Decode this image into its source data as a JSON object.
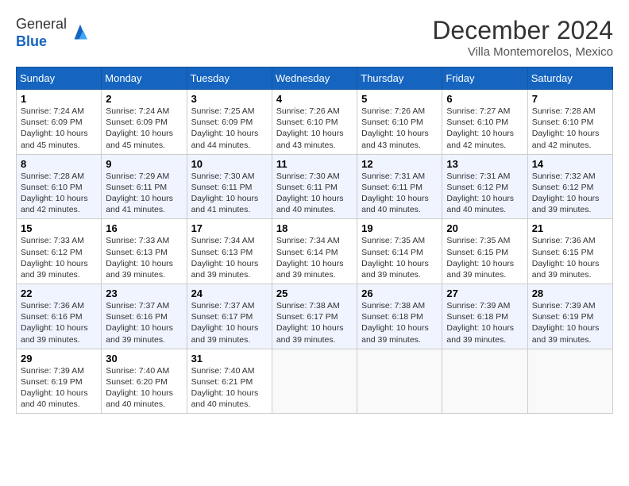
{
  "header": {
    "logo_line1": "General",
    "logo_line2": "Blue",
    "month_title": "December 2024",
    "location": "Villa Montemorelos, Mexico"
  },
  "weekdays": [
    "Sunday",
    "Monday",
    "Tuesday",
    "Wednesday",
    "Thursday",
    "Friday",
    "Saturday"
  ],
  "weeks": [
    [
      {
        "day": "1",
        "info": "Sunrise: 7:24 AM\nSunset: 6:09 PM\nDaylight: 10 hours\nand 45 minutes."
      },
      {
        "day": "2",
        "info": "Sunrise: 7:24 AM\nSunset: 6:09 PM\nDaylight: 10 hours\nand 45 minutes."
      },
      {
        "day": "3",
        "info": "Sunrise: 7:25 AM\nSunset: 6:09 PM\nDaylight: 10 hours\nand 44 minutes."
      },
      {
        "day": "4",
        "info": "Sunrise: 7:26 AM\nSunset: 6:10 PM\nDaylight: 10 hours\nand 43 minutes."
      },
      {
        "day": "5",
        "info": "Sunrise: 7:26 AM\nSunset: 6:10 PM\nDaylight: 10 hours\nand 43 minutes."
      },
      {
        "day": "6",
        "info": "Sunrise: 7:27 AM\nSunset: 6:10 PM\nDaylight: 10 hours\nand 42 minutes."
      },
      {
        "day": "7",
        "info": "Sunrise: 7:28 AM\nSunset: 6:10 PM\nDaylight: 10 hours\nand 42 minutes."
      }
    ],
    [
      {
        "day": "8",
        "info": "Sunrise: 7:28 AM\nSunset: 6:10 PM\nDaylight: 10 hours\nand 42 minutes."
      },
      {
        "day": "9",
        "info": "Sunrise: 7:29 AM\nSunset: 6:11 PM\nDaylight: 10 hours\nand 41 minutes."
      },
      {
        "day": "10",
        "info": "Sunrise: 7:30 AM\nSunset: 6:11 PM\nDaylight: 10 hours\nand 41 minutes."
      },
      {
        "day": "11",
        "info": "Sunrise: 7:30 AM\nSunset: 6:11 PM\nDaylight: 10 hours\nand 40 minutes."
      },
      {
        "day": "12",
        "info": "Sunrise: 7:31 AM\nSunset: 6:11 PM\nDaylight: 10 hours\nand 40 minutes."
      },
      {
        "day": "13",
        "info": "Sunrise: 7:31 AM\nSunset: 6:12 PM\nDaylight: 10 hours\nand 40 minutes."
      },
      {
        "day": "14",
        "info": "Sunrise: 7:32 AM\nSunset: 6:12 PM\nDaylight: 10 hours\nand 39 minutes."
      }
    ],
    [
      {
        "day": "15",
        "info": "Sunrise: 7:33 AM\nSunset: 6:12 PM\nDaylight: 10 hours\nand 39 minutes."
      },
      {
        "day": "16",
        "info": "Sunrise: 7:33 AM\nSunset: 6:13 PM\nDaylight: 10 hours\nand 39 minutes."
      },
      {
        "day": "17",
        "info": "Sunrise: 7:34 AM\nSunset: 6:13 PM\nDaylight: 10 hours\nand 39 minutes."
      },
      {
        "day": "18",
        "info": "Sunrise: 7:34 AM\nSunset: 6:14 PM\nDaylight: 10 hours\nand 39 minutes."
      },
      {
        "day": "19",
        "info": "Sunrise: 7:35 AM\nSunset: 6:14 PM\nDaylight: 10 hours\nand 39 minutes."
      },
      {
        "day": "20",
        "info": "Sunrise: 7:35 AM\nSunset: 6:15 PM\nDaylight: 10 hours\nand 39 minutes."
      },
      {
        "day": "21",
        "info": "Sunrise: 7:36 AM\nSunset: 6:15 PM\nDaylight: 10 hours\nand 39 minutes."
      }
    ],
    [
      {
        "day": "22",
        "info": "Sunrise: 7:36 AM\nSunset: 6:16 PM\nDaylight: 10 hours\nand 39 minutes."
      },
      {
        "day": "23",
        "info": "Sunrise: 7:37 AM\nSunset: 6:16 PM\nDaylight: 10 hours\nand 39 minutes."
      },
      {
        "day": "24",
        "info": "Sunrise: 7:37 AM\nSunset: 6:17 PM\nDaylight: 10 hours\nand 39 minutes."
      },
      {
        "day": "25",
        "info": "Sunrise: 7:38 AM\nSunset: 6:17 PM\nDaylight: 10 hours\nand 39 minutes."
      },
      {
        "day": "26",
        "info": "Sunrise: 7:38 AM\nSunset: 6:18 PM\nDaylight: 10 hours\nand 39 minutes."
      },
      {
        "day": "27",
        "info": "Sunrise: 7:39 AM\nSunset: 6:18 PM\nDaylight: 10 hours\nand 39 minutes."
      },
      {
        "day": "28",
        "info": "Sunrise: 7:39 AM\nSunset: 6:19 PM\nDaylight: 10 hours\nand 39 minutes."
      }
    ],
    [
      {
        "day": "29",
        "info": "Sunrise: 7:39 AM\nSunset: 6:19 PM\nDaylight: 10 hours\nand 40 minutes."
      },
      {
        "day": "30",
        "info": "Sunrise: 7:40 AM\nSunset: 6:20 PM\nDaylight: 10 hours\nand 40 minutes."
      },
      {
        "day": "31",
        "info": "Sunrise: 7:40 AM\nSunset: 6:21 PM\nDaylight: 10 hours\nand 40 minutes."
      },
      null,
      null,
      null,
      null
    ]
  ]
}
